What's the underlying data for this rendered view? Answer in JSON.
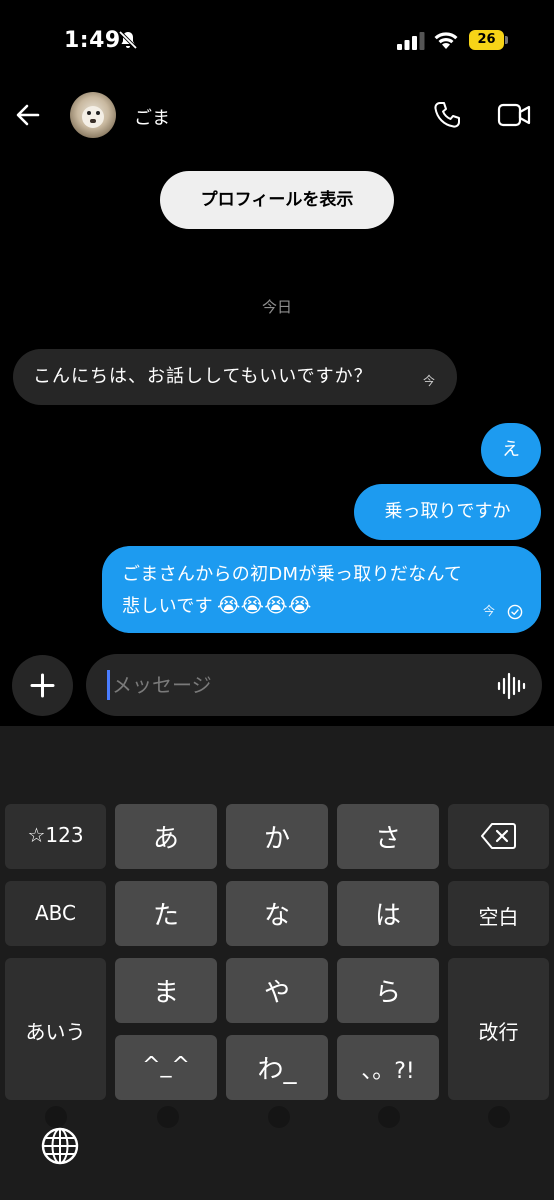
{
  "status": {
    "time": "1:49",
    "battery": "26"
  },
  "header": {
    "contact_name": "ごま"
  },
  "profile_button": "プロフィールを表示",
  "date_label": "今日",
  "messages": [
    {
      "text": "こんにちは、お話ししてもいいですか？",
      "time": "今"
    },
    {
      "text": "え"
    },
    {
      "text": "乗っ取りですか"
    },
    {
      "line1": "ごまさんからの初DMが乗っ取りだなんて",
      "line2": "悲しいです",
      "emojis": "😭😭😭😭",
      "time": "今"
    }
  ],
  "composer": {
    "placeholder": "メッセージ"
  },
  "keyboard": {
    "sym": "☆123",
    "a": "あ",
    "ka": "か",
    "sa": "さ",
    "abc": "ABC",
    "ta": "た",
    "na": "な",
    "ha": "は",
    "space": "空白",
    "kana": "あいう",
    "ma": "ま",
    "ya": "や",
    "ra": "ら",
    "enter": "改行",
    "dakuten": "^_^",
    "wa": "わ_",
    "punct": "、。?!"
  },
  "colors": {
    "accent": "#1d9bf0",
    "bubble_in": "#262626",
    "battery": "#f7d417"
  }
}
